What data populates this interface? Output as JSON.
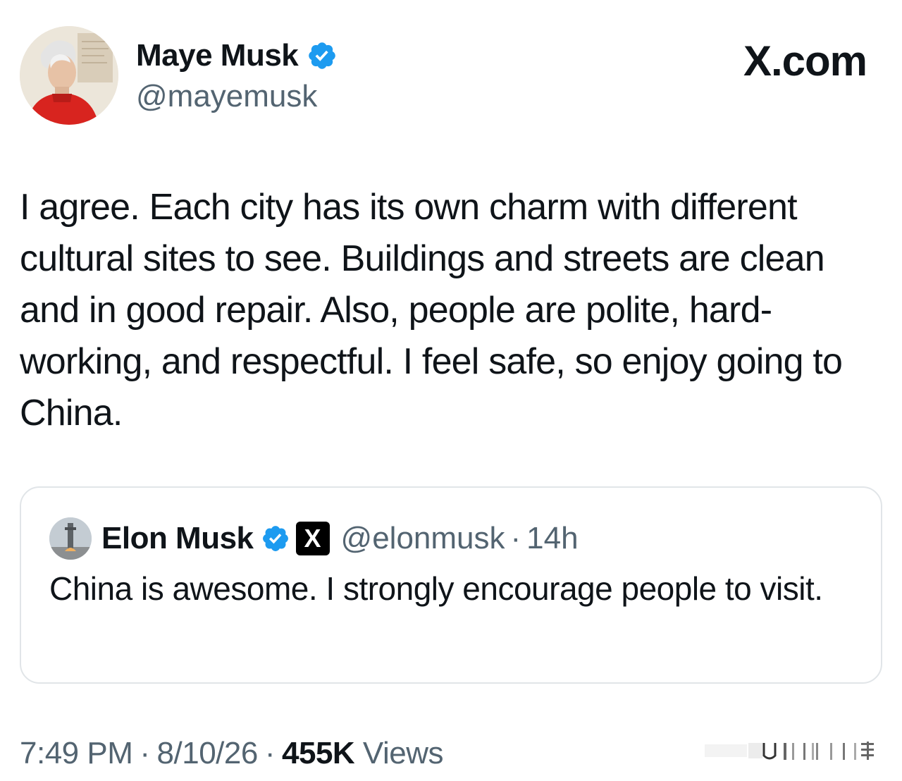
{
  "author": {
    "display_name": "Maye Musk",
    "handle": "@mayemusk",
    "verified": true,
    "avatar_icon": "profile-photo-red-top"
  },
  "brand": "X.com",
  "tweet_text": "I agree. Each city has its own charm with different cultural sites to see. Buildings and streets are clean and in good repair. Also, people are polite, hard-working, and respectful. I feel safe, so enjoy going to China.",
  "quoted_tweet": {
    "display_name": "Elon Musk",
    "verified": true,
    "affiliation_badge": "X",
    "handle": "@elonmusk",
    "separator": "·",
    "time_ago": "14h",
    "text": "China is awesome. I strongly encourage people to visit."
  },
  "footer": {
    "time": "7:49 PM",
    "date": "8/10/26",
    "separator": "·",
    "views_count": "455K",
    "views_label": "Views"
  },
  "colors": {
    "text_primary": "#0f1419",
    "text_secondary": "#536471",
    "verified_blue": "#1d9bf0",
    "border": "#e1e5e8"
  }
}
